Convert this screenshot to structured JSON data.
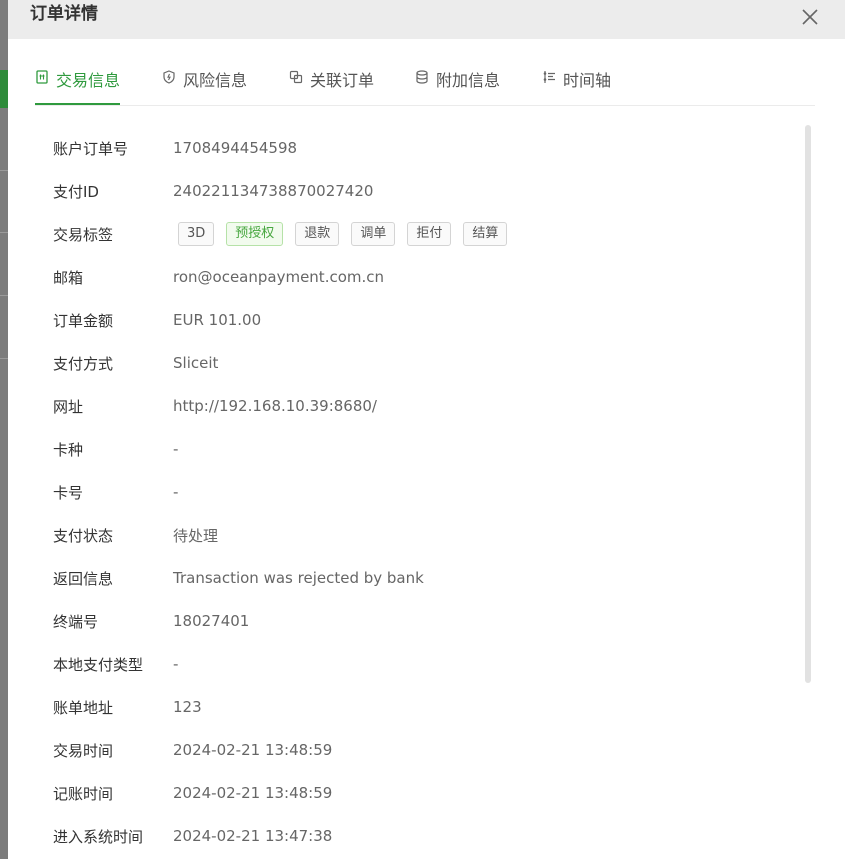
{
  "modal": {
    "title": "订单详情"
  },
  "tabs": [
    {
      "label": "交易信息",
      "icon": "transaction-icon",
      "active": true
    },
    {
      "label": "风险信息",
      "icon": "shield-icon",
      "active": false
    },
    {
      "label": "关联订单",
      "icon": "link-orders-icon",
      "active": false
    },
    {
      "label": "附加信息",
      "icon": "database-icon",
      "active": false
    },
    {
      "label": "时间轴",
      "icon": "timeline-icon",
      "active": false
    }
  ],
  "fields": {
    "account_order_no": {
      "label": "账户订单号",
      "value": "1708494454598"
    },
    "payment_id": {
      "label": "支付ID",
      "value": "240221134738870027420"
    },
    "trade_tags": {
      "label": "交易标签"
    },
    "email": {
      "label": "邮箱",
      "value": "ron@oceanpayment.com.cn"
    },
    "order_amount": {
      "label": "订单金额",
      "value": "EUR 101.00"
    },
    "payment_method": {
      "label": "支付方式",
      "value": "Sliceit"
    },
    "website": {
      "label": "网址",
      "value": "http://192.168.10.39:8680/"
    },
    "card_type": {
      "label": "卡种",
      "value": "-"
    },
    "card_no": {
      "label": "卡号",
      "value": "-"
    },
    "payment_status": {
      "label": "支付状态",
      "value": "待处理"
    },
    "return_info": {
      "label": "返回信息",
      "value": "Transaction was rejected by bank"
    },
    "terminal_no": {
      "label": "终端号",
      "value": "18027401"
    },
    "local_payment_type": {
      "label": "本地支付类型",
      "value": "-"
    },
    "billing_address": {
      "label": "账单地址",
      "value": "123"
    },
    "trade_time": {
      "label": "交易时间",
      "value": "2024-02-21 13:48:59"
    },
    "booking_time": {
      "label": "记账时间",
      "value": "2024-02-21 13:48:59"
    },
    "system_entry_time": {
      "label": "进入系统时间",
      "value": "2024-02-21 13:47:38"
    }
  },
  "tags": [
    {
      "label": "3D",
      "style": "default"
    },
    {
      "label": "预授权",
      "style": "green"
    },
    {
      "label": "退款",
      "style": "default"
    },
    {
      "label": "调单",
      "style": "default"
    },
    {
      "label": "拒付",
      "style": "default"
    },
    {
      "label": "结算",
      "style": "default"
    }
  ],
  "colors": {
    "accent": "#2f9a3e",
    "header_bg": "#ececec",
    "tag_green": "#47a73f"
  }
}
